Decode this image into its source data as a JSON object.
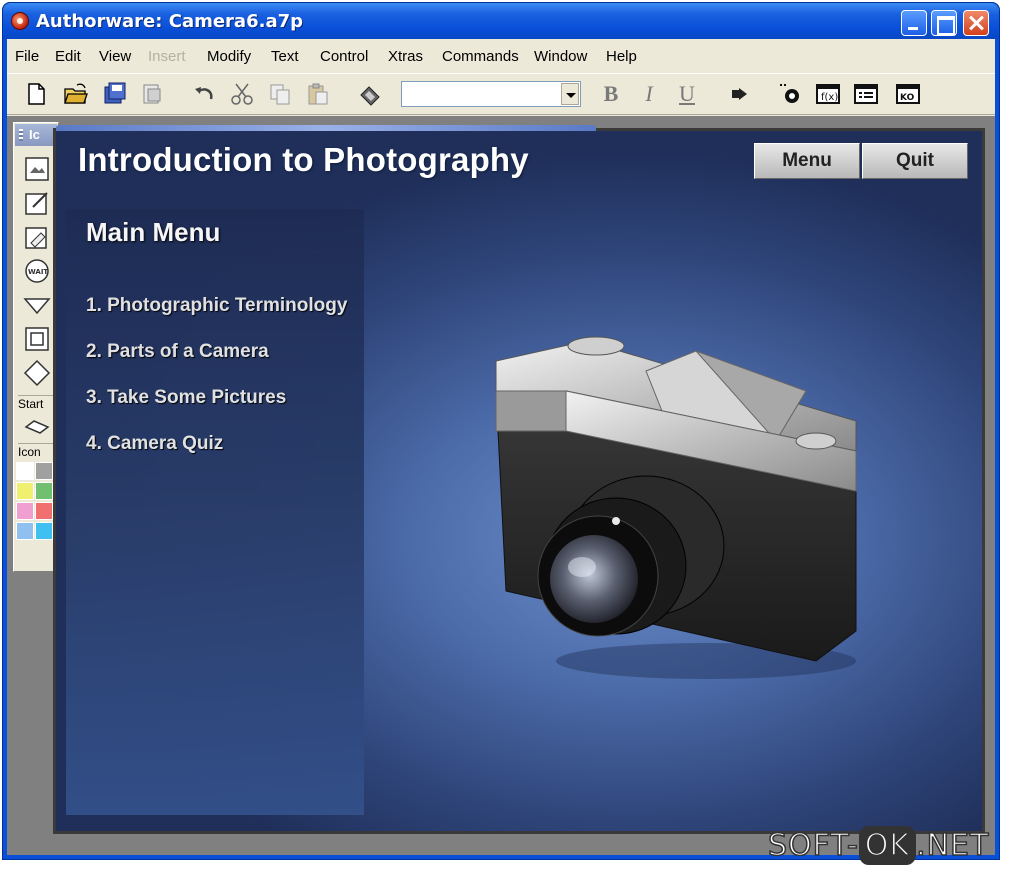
{
  "window": {
    "title": "Authorware: Camera6.a7p"
  },
  "menubar": {
    "items": [
      {
        "label": "File",
        "enabled": true
      },
      {
        "label": "Edit",
        "enabled": true
      },
      {
        "label": "View",
        "enabled": true
      },
      {
        "label": "Insert",
        "enabled": false
      },
      {
        "label": "Modify",
        "enabled": true
      },
      {
        "label": "Text",
        "enabled": true
      },
      {
        "label": "Control",
        "enabled": true
      },
      {
        "label": "Xtras",
        "enabled": true
      },
      {
        "label": "Commands",
        "enabled": true
      },
      {
        "label": "Window",
        "enabled": true
      },
      {
        "label": "Help",
        "enabled": true
      }
    ]
  },
  "toolbar": {
    "font_combo_value": "",
    "bold_label": "B",
    "italic_label": "I",
    "underline_label": "U",
    "icons": [
      "new-file-icon",
      "open-folder-icon",
      "save-all-icon",
      "import-icon",
      "undo-icon",
      "cut-icon",
      "copy-icon",
      "paste-icon",
      "find-icon",
      "run-icon",
      "control-panel-icon",
      "functions-icon",
      "variables-icon",
      "knowledge-objects-icon"
    ]
  },
  "palette": {
    "title": "Ic",
    "start_label": "Start",
    "icon_label": "Icon",
    "icons": [
      "display-icon",
      "motion-icon",
      "erase-icon",
      "wait-icon",
      "navigate-icon",
      "framework-icon",
      "decision-icon",
      "interaction-icon"
    ],
    "swatches": [
      "#ffffff",
      "#a0a0a0",
      "#f0f070",
      "#70c070",
      "#f0a0d0",
      "#f07070",
      "#90c0f0",
      "#40c0f0"
    ]
  },
  "stage": {
    "title": "Introduction to Photography",
    "menu_button": "Menu",
    "quit_button": "Quit",
    "panel_heading": "Main Menu",
    "menu_items": [
      "1. Photographic Terminology",
      "2. Parts of a Camera",
      "3. Take Some Pictures",
      "4. Camera Quiz"
    ]
  },
  "watermark": {
    "left": "SOFT-",
    "ok": "OK",
    "right": ".NET"
  }
}
